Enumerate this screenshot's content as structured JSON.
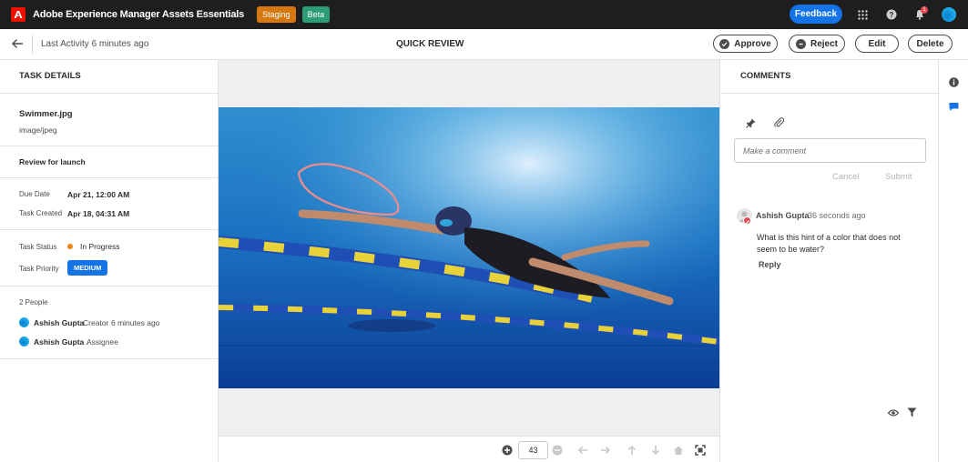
{
  "header": {
    "app_title": "Adobe Experience Manager Assets Essentials",
    "staging_label": "Staging",
    "beta_label": "Beta",
    "feedback_label": "Feedback",
    "notification_count": "1",
    "icons": [
      "adobe-logo",
      "apps-grid-icon",
      "help-icon",
      "bell-icon",
      "user-avatar"
    ]
  },
  "subheader": {
    "last_activity": "Last Activity 6 minutes ago",
    "title": "QUICK REVIEW",
    "approve_label": "Approve",
    "reject_label": "Reject",
    "edit_label": "Edit",
    "delete_label": "Delete"
  },
  "task": {
    "heading": "TASK DETAILS",
    "file_name": "Swimmer.jpg",
    "file_type": "image/jpeg",
    "review_name": "Review for launch",
    "due_date_label": "Due Date",
    "due_date": "Apr 21, 12:00 AM",
    "created_label": "Task Created",
    "created": "Apr 18, 04:31 AM",
    "status_label": "Task Status",
    "status": "In Progress",
    "priority_label": "Task Priority",
    "priority": "MEDIUM",
    "people_count": "2 People",
    "people": [
      {
        "name": "Ashish Gupta",
        "role": "Creator",
        "time": "6 minutes ago"
      },
      {
        "name": "Ashish Gupta .",
        "role": "Assignee"
      }
    ]
  },
  "viewer": {
    "page_number": "43"
  },
  "comments": {
    "heading": "COMMENTS",
    "input_placeholder": "Make a comment",
    "cancel_label": "Cancel",
    "submit_label": "Submit",
    "items": [
      {
        "author": "Ashish Gupta",
        "time": "36 seconds ago",
        "text": "What is this hint of a color that does not seem to be water?",
        "reply_label": "Reply"
      }
    ]
  },
  "colors": {
    "accent": "#1473e6",
    "staging": "#d4780f",
    "beta": "#2d9d78",
    "status_dot": "#e68619",
    "annotation": "#f08b8b"
  }
}
